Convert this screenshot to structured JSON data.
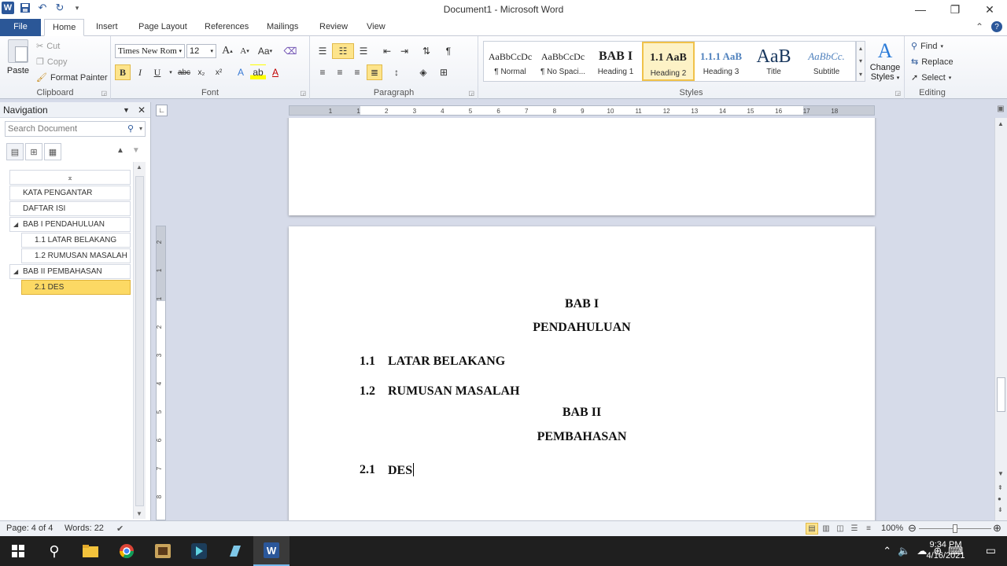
{
  "window": {
    "title": "Document1 - Microsoft Word"
  },
  "tabs": [
    {
      "label": "File"
    },
    {
      "label": "Home"
    },
    {
      "label": "Insert"
    },
    {
      "label": "Page Layout"
    },
    {
      "label": "References"
    },
    {
      "label": "Mailings"
    },
    {
      "label": "Review"
    },
    {
      "label": "View"
    }
  ],
  "ribbon": {
    "clipboard": {
      "label": "Clipboard",
      "paste": "Paste",
      "cut": "Cut",
      "copy": "Copy",
      "format_painter": "Format Painter"
    },
    "font": {
      "label": "Font",
      "family": "Times New Rom",
      "size": "12",
      "aa": "Aa"
    },
    "paragraph": {
      "label": "Paragraph"
    },
    "styles": {
      "label": "Styles",
      "items": [
        {
          "preview": "AaBbCcDc",
          "name": "¶ Normal"
        },
        {
          "preview": "AaBbCcDc",
          "name": "¶ No Spaci..."
        },
        {
          "preview": "BAB I",
          "name": "Heading 1"
        },
        {
          "preview": "1.1  AaB",
          "name": "Heading 2"
        },
        {
          "preview": "1.1.1  AaB",
          "name": "Heading 3"
        },
        {
          "preview": "AaB",
          "name": "Title"
        },
        {
          "preview": "AaBbCc.",
          "name": "Subtitle"
        }
      ],
      "change_styles_1": "Change",
      "change_styles_2": "Styles"
    },
    "editing": {
      "label": "Editing",
      "find": "Find",
      "replace": "Replace",
      "select": "Select"
    }
  },
  "nav": {
    "title": "Navigation",
    "search_placeholder": "Search Document",
    "items": [
      {
        "label": "KATA PENGANTAR"
      },
      {
        "label": "DAFTAR ISI"
      },
      {
        "label": "BAB I  PENDAHULUAN"
      },
      {
        "label": "1.1 LATAR BELAKANG"
      },
      {
        "label": "1.2 RUMUSAN MASALAH"
      },
      {
        "label": "BAB II  PEMBAHASAN"
      },
      {
        "label": "2.1 DES"
      }
    ]
  },
  "ruler": {
    "h_labels": [
      "1",
      "1",
      "2",
      "3",
      "4",
      "5",
      "6",
      "7",
      "8",
      "9",
      "10",
      "11",
      "12",
      "13",
      "14",
      "15",
      "16",
      "17",
      "18"
    ],
    "v_labels": [
      "2",
      "1",
      "1",
      "2",
      "3",
      "4",
      "5",
      "6",
      "7",
      "8"
    ]
  },
  "document": {
    "h1_a": "BAB I",
    "h1_a_sub": "PENDAHULUAN",
    "s11_num": "1.1",
    "s11_title": "LATAR BELAKANG",
    "s12_num": "1.2",
    "s12_title": "RUMUSAN MASALAH",
    "h1_b": "BAB II",
    "h1_b_sub": "PEMBAHASAN",
    "s21_num": "2.1",
    "s21_title": "DES"
  },
  "status": {
    "page": "Page: 4 of 4",
    "words": "Words: 22",
    "zoom": "100%"
  },
  "taskbar": {
    "time": "9:34 PM",
    "date": "4/16/2021"
  }
}
